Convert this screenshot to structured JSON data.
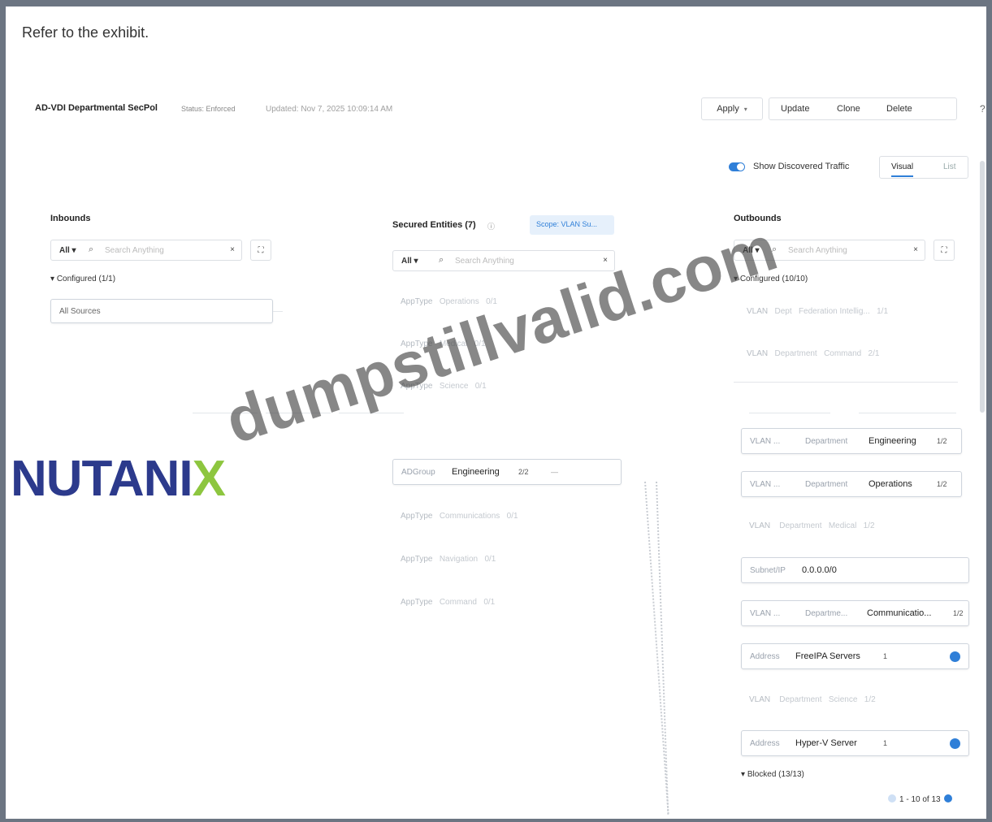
{
  "question": "Refer to the exhibit.",
  "header": {
    "policy_name": "AD-VDI Departmental SecPol",
    "status": "Status: Enforced",
    "updated": "Updated: Nov 7, 2025 10:09:14 AM",
    "apply_label": "Apply",
    "update_label": "Update",
    "clone_label": "Clone",
    "delete_label": "Delete",
    "help": "?",
    "close": "×"
  },
  "view": {
    "show_discovered_label": "Show Discovered Traffic",
    "visual_tab": "Visual",
    "list_tab": "List"
  },
  "inbounds": {
    "title": "Inbounds",
    "filter": "All",
    "search_placeholder": "Search Anything",
    "configured": "Configured (1/1)",
    "items": [
      {
        "value": "All Sources"
      }
    ]
  },
  "secured": {
    "title": "Secured Entities (7)",
    "scope": "Scope: VLAN Su...",
    "filter": "All",
    "search_placeholder": "Search Anything",
    "faded": [
      {
        "type": "AppType",
        "value": "Operations",
        "count": "0/1"
      },
      {
        "type": "AppType",
        "value": "Medical",
        "count": "0/1"
      },
      {
        "type": "AppType",
        "value": "Science",
        "count": "0/1"
      },
      {
        "type": "AppType",
        "value": "Communications",
        "count": "0/1"
      },
      {
        "type": "AppType",
        "value": "Navigation",
        "count": "0/1"
      },
      {
        "type": "AppType",
        "value": "Command",
        "count": "0/1"
      }
    ],
    "active": {
      "type": "ADGroup",
      "value": "Engineering",
      "count": "2/2"
    }
  },
  "outbounds": {
    "title": "Outbounds",
    "filter": "All",
    "search_placeholder": "Search Anything",
    "configured": "Configured (10/10)",
    "faded_top": [
      {
        "type": "VLAN",
        "cat": "Dept",
        "value": "Federation Intellig...",
        "count": "1/1"
      },
      {
        "type": "VLAN",
        "cat": "Department",
        "value": "Command",
        "count": "2/1"
      }
    ],
    "items": [
      {
        "type": "VLAN ...",
        "cat": "Department",
        "value": "Engineering",
        "count": "1/2"
      },
      {
        "type": "VLAN ...",
        "cat": "Department",
        "value": "Operations",
        "count": "1/2"
      },
      {
        "type": "Subnet/IP",
        "cat": "",
        "value": "0.0.0.0/0",
        "count": ""
      },
      {
        "type": "VLAN ...",
        "cat": "Departme...",
        "value": "Communicatio...",
        "count": "1/2"
      },
      {
        "type": "Address",
        "cat": "",
        "value": "FreeIPA Servers",
        "count": "1"
      },
      {
        "type": "Address",
        "cat": "",
        "value": "Hyper-V Server",
        "count": "1"
      }
    ],
    "faded_mid": [
      {
        "type": "VLAN",
        "cat": "Department",
        "value": "Medical",
        "count": "1/2"
      },
      {
        "type": "VLAN",
        "cat": "Department",
        "value": "Science",
        "count": "1/2"
      }
    ],
    "blocked": "Blocked (13/13)",
    "pager": "1 - 10 of 13"
  },
  "watermark": {
    "logo_main": "NUTANI",
    "logo_x": "X",
    "text": "dumpstillvalid.com"
  },
  "colors": {
    "accent": "#2f7fd8",
    "logo_blue": "#2c3a8c",
    "logo_green": "#8dc63f"
  }
}
